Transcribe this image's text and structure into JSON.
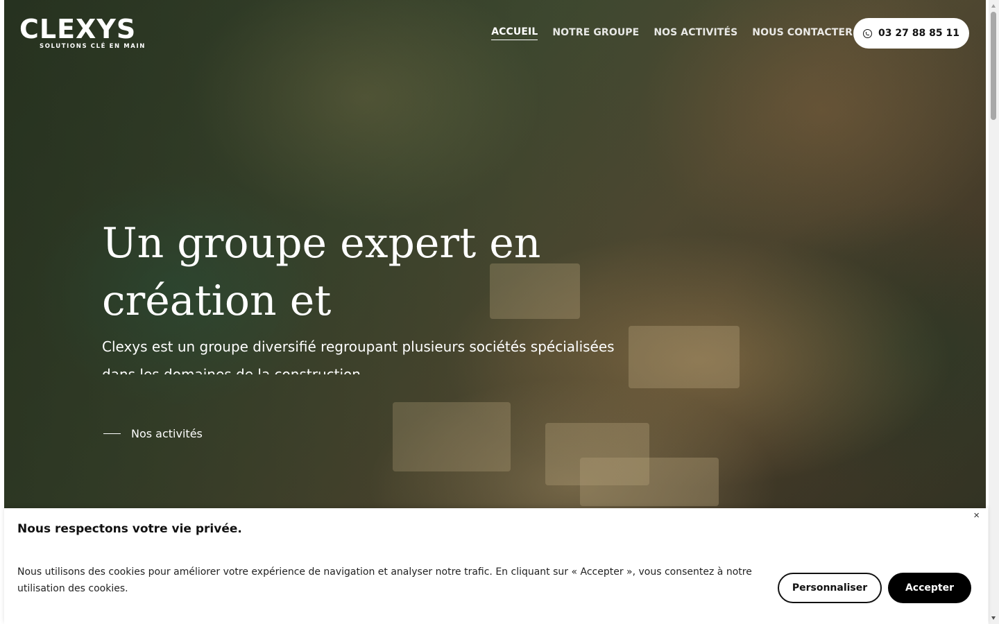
{
  "brand": {
    "name": "CLEXYS",
    "tagline": "SOLUTIONS CLÉ EN MAIN"
  },
  "nav": {
    "items": [
      {
        "label": "ACCUEIL",
        "active": true
      },
      {
        "label": "NOTRE GROUPE",
        "active": false
      },
      {
        "label": "NOS ACTIVITÉS",
        "active": false
      },
      {
        "label": "NOUS CONTACTER",
        "active": false
      }
    ],
    "phone": "03 27 88 85 11",
    "phone_icon": "whatsapp-icon"
  },
  "hero": {
    "title": "Un groupe expert en création et aménagement",
    "description": "Clexys est un groupe diversifié regroupant plusieurs sociétés spécialisées dans les domaines de la construction",
    "cta_label": "Nos activités"
  },
  "cookie_banner": {
    "title": "Nous respectons votre vie privée.",
    "text": "Nous utilisons des cookies pour améliorer votre expérience de navigation et analyser notre trafic. En cliquant sur « Accepter », vous consentez à notre utilisation des cookies.",
    "close_label": "×",
    "customize_label": "Personnaliser",
    "accept_label": "Accepter"
  },
  "colors": {
    "primary_dark": "#000000",
    "text_light": "#ffffff",
    "hero_overlay": "#3d4a31"
  }
}
